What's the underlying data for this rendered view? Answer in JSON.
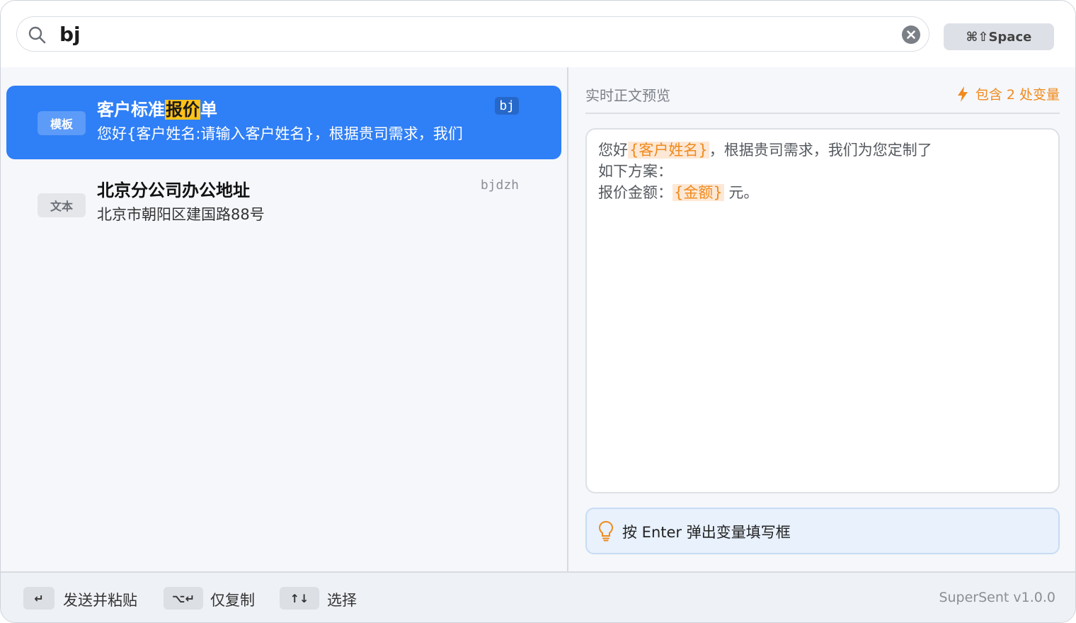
{
  "search": {
    "query": "bj",
    "hotkey_label": "⌘⇧Space"
  },
  "results": [
    {
      "type_label": "模板",
      "title_before": "客户标准",
      "title_highlight": "报价",
      "title_after": "单",
      "snippet": "您好{客户姓名:请输入客户姓名}，根据贵司需求，我们",
      "keyword": "bj",
      "selected": true
    },
    {
      "type_label": "文本",
      "title_before": "北京分公司办公地址",
      "title_highlight": "",
      "title_after": "",
      "snippet": "北京市朝阳区建国路88号",
      "keyword": "bjdzh",
      "selected": false
    }
  ],
  "preview": {
    "label": "实时正文预览",
    "variable_count": "包含 2 处变量",
    "body": {
      "part1": "您好",
      "var1": "{客户姓名}",
      "part2": "，根据贵司需求，我们为您定制了",
      "line2": "如下方案：",
      "part3": "报价金额：",
      "var2": "{金额}",
      "part4": " 元。"
    },
    "tip": "按 Enter 弹出变量填写框"
  },
  "footer": {
    "hints": [
      {
        "key": "↵",
        "label": "发送并粘贴"
      },
      {
        "key": "⌥↵",
        "label": "仅复制"
      },
      {
        "key": "↑↓",
        "label": "选择"
      }
    ],
    "version": "SuperSent v1.0.0"
  },
  "colors": {
    "accent": "#2f7ff6",
    "highlight": "#ffc21a",
    "variable": "#f08a1c"
  }
}
